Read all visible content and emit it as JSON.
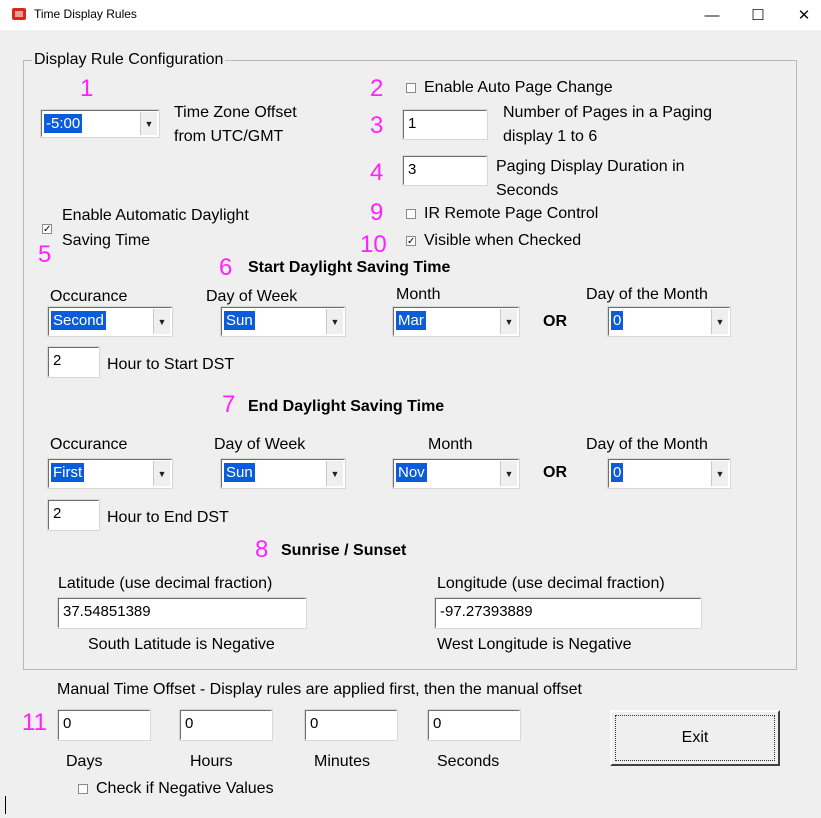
{
  "window": {
    "title": "Time Display Rules",
    "minimize": "—",
    "maximize": "☐",
    "close": "✕"
  },
  "group": {
    "title": "Display Rule Configuration"
  },
  "markers": {
    "m1": "1",
    "m2": "2",
    "m3": "3",
    "m4": "4",
    "m5": "5",
    "m6": "6",
    "m7": "7",
    "m8": "8",
    "m9": "9",
    "m10": "10",
    "m11": "11"
  },
  "timezone": {
    "value": "-5:00",
    "label_line1": "Time Zone Offset",
    "label_line2": "from UTC/GMT"
  },
  "auto_page": {
    "checked": false,
    "label": "Enable Auto Page Change"
  },
  "pages": {
    "value": "1",
    "label_line1": "Number of Pages in a Paging",
    "label_line2": "display 1 to 6"
  },
  "duration": {
    "value": "3",
    "label_line1": "Paging Display Duration in",
    "label_line2": "Seconds"
  },
  "ir_remote": {
    "checked": false,
    "label": "IR Remote Page Control"
  },
  "visible_checked": {
    "checked": true,
    "label": "Visible when Checked"
  },
  "dst_enable": {
    "checked": true,
    "label_line1": "Enable Automatic Daylight",
    "label_line2": "Saving Time"
  },
  "start_dst": {
    "title": "Start Daylight Saving Time",
    "occurance_label": "Occurance",
    "occurance": "Second",
    "dow_label": "Day of Week",
    "dow": "Sun",
    "month_label": "Month",
    "month": "Mar",
    "or": "OR",
    "dom_label": "Day of the Month",
    "dom": "0",
    "hour": "2",
    "hour_label": "Hour to Start DST"
  },
  "end_dst": {
    "title": "End Daylight Saving Time",
    "occurance_label": "Occurance",
    "occurance": "First",
    "dow_label": "Day of Week",
    "dow": "Sun",
    "month_label": "Month",
    "month": "Nov",
    "or": "OR",
    "dom_label": "Day of the Month",
    "dom": "0",
    "hour": "2",
    "hour_label": "Hour to End DST"
  },
  "sun": {
    "title": "Sunrise / Sunset",
    "lat_label": "Latitude (use decimal fraction)",
    "lat": "37.54851389",
    "lat_note": "South Latitude is Negative",
    "lon_label": "Longitude (use decimal fraction)",
    "lon": "-97.27393889",
    "lon_note": "West Longitude is Negative"
  },
  "manual": {
    "label": "Manual Time Offset -  Display rules are applied first, then the manual offset",
    "days": "0",
    "hours": "0",
    "minutes": "0",
    "seconds": "0",
    "days_label": "Days",
    "hours_label": "Hours",
    "minutes_label": "Minutes",
    "seconds_label": "Seconds",
    "negative_checked": false,
    "negative_label": "Check if Negative Values"
  },
  "exit": {
    "label": "Exit"
  },
  "icons": {
    "dropdown": "▼",
    "check": "✓"
  }
}
